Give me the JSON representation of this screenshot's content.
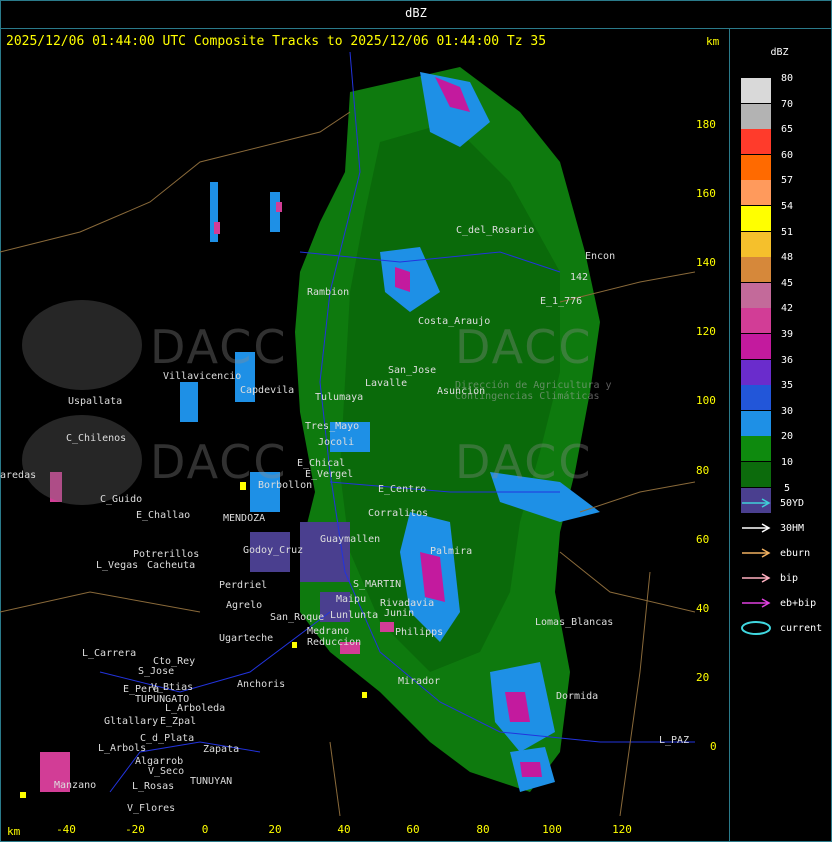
{
  "window": {
    "title": "dBZ"
  },
  "map": {
    "subtitle": "2025/12/06 01:44:00 UTC Composite Tracks to 2025/12/06 01:44:00 Tz 35",
    "unit_label_top": "km",
    "unit_label_bottom": "km",
    "y_ticks": [
      "180",
      "160",
      "140",
      "120",
      "100",
      "80",
      "60",
      "40",
      "20",
      "0"
    ],
    "x_ticks": [
      "-40",
      "-20",
      "0",
      "20",
      "40",
      "60",
      "80",
      "100",
      "120"
    ],
    "watermark_text": "DACC",
    "watermark_subtext": "Dirección de Agricultura y Contingencias Climáticas",
    "places": [
      "Uspallata",
      "C_Chilenos",
      "aredas",
      "C_Guido",
      "E_Challao",
      "Potrerillos",
      "L_Vegas",
      "Cacheuta",
      "Villavicencio",
      "Capdevila",
      "Rambion",
      "San_Jose",
      "Asuncion",
      "Tres_Mayo",
      "Jocoli",
      "Lavalle",
      "E_Chical",
      "E_Vergel",
      "Borbollon",
      "E_Centro",
      "Corralitos",
      "Perdriel",
      "Agrelo",
      "Ugarteche",
      "Cto_Rey",
      "S_Jose",
      "E_Pera",
      "V_Btias",
      "Anchoris",
      "TUPUNGATO",
      "L_Arboleda",
      "Gltallary",
      "E_Zpal",
      "L_Arbols",
      "C_d_Plata",
      "Zapata",
      "Algarrob",
      "V_Seco",
      "TUNUYAN",
      "Manzano",
      "L_Rosas",
      "V_Flores",
      "S_MARTIN",
      "Rivadavia",
      "Reduccion",
      "Medrano",
      "Junin",
      "Mirador",
      "Lomas_Blancas",
      "Dormida",
      "L_PAZ",
      "E_1_776",
      "Encon",
      "142",
      "L_Carrera",
      "C_del_Rosario",
      "Costa_Araujo",
      "Tulumaya",
      "Palmira",
      "Philipps",
      "San_Roque",
      "Lunlunta",
      "Maipu",
      "Guaymallen",
      "Godoy_Cruz",
      "MENDOZA"
    ]
  },
  "legend": {
    "title": "dBZ",
    "levels": [
      {
        "label": "80",
        "color": "#d9d9d9"
      },
      {
        "label": "70",
        "color": "#b3b3b3"
      },
      {
        "label": "65",
        "color": "#ff3b2b"
      },
      {
        "label": "60",
        "color": "#ff6a00"
      },
      {
        "label": "57",
        "color": "#ff9a5c"
      },
      {
        "label": "54",
        "color": "#ffff00"
      },
      {
        "label": "51",
        "color": "#f5c02c"
      },
      {
        "label": "48",
        "color": "#d6883a"
      },
      {
        "label": "45",
        "color": "#c36a9a"
      },
      {
        "label": "42",
        "color": "#d23d96"
      },
      {
        "label": "39",
        "color": "#c31a9e"
      },
      {
        "label": "36",
        "color": "#6a2ccc"
      },
      {
        "label": "35",
        "color": "#2256d9"
      },
      {
        "label": "30",
        "color": "#1e90e6"
      },
      {
        "label": "20",
        "color": "#0e8a0e"
      },
      {
        "label": "10",
        "color": "#0c6b0c"
      },
      {
        "label": "5",
        "color": "#4a3f8f"
      }
    ],
    "tracks": [
      {
        "label": "50YD",
        "color": "#3fd0d8"
      },
      {
        "label": "30HM",
        "color": "#ffffff"
      },
      {
        "label": "eburn",
        "color": "#f0b060"
      },
      {
        "label": "bip",
        "color": "#ffb0c0"
      },
      {
        "label": "eb+bip",
        "color": "#e040e0"
      },
      {
        "label": "current",
        "color": "#40d8e0"
      }
    ]
  }
}
